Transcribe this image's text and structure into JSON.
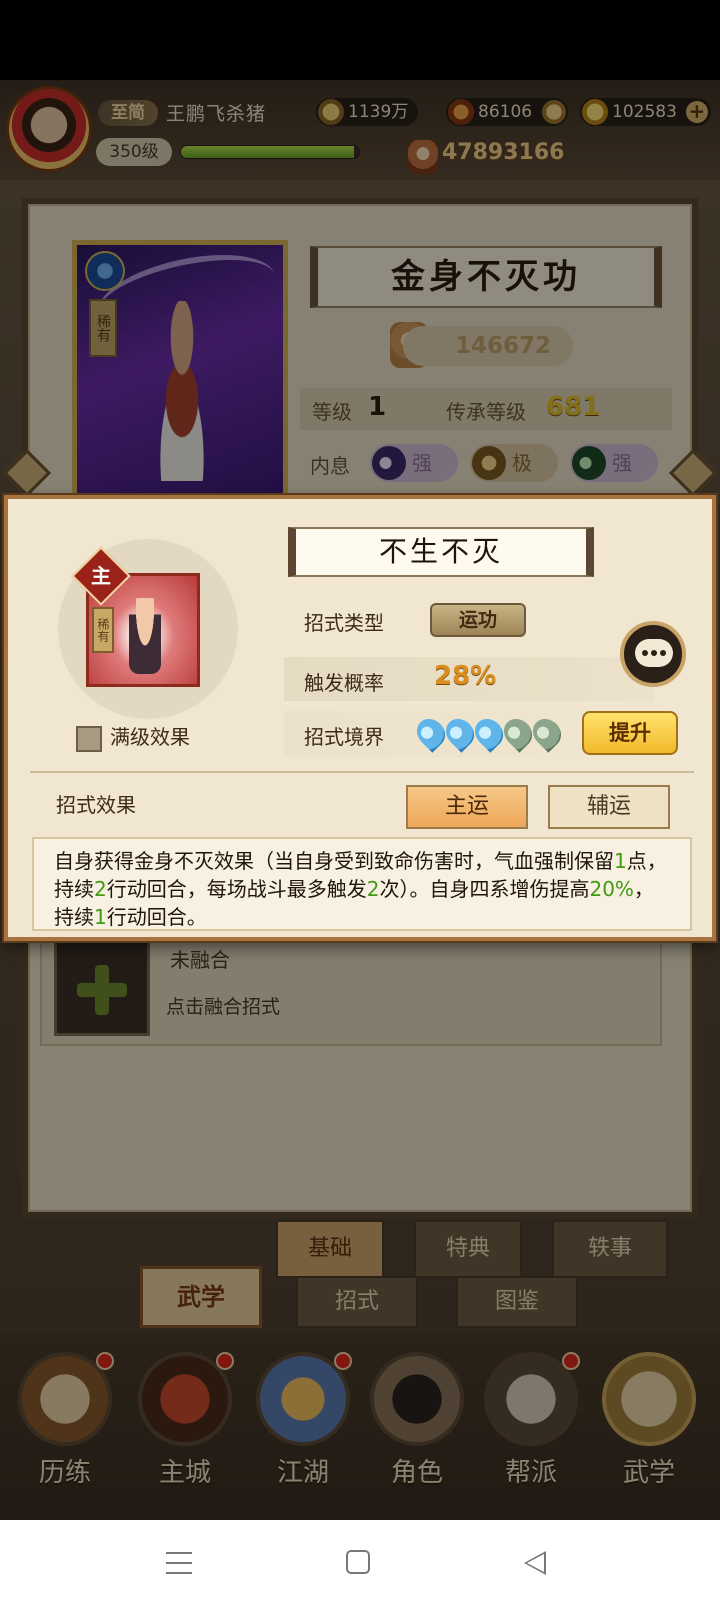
{
  "player": {
    "vip": "至简",
    "name": "王鹏飞杀猪",
    "level": "350级",
    "exp_fraction": 0.97,
    "power": "47893166"
  },
  "resources": {
    "coins": "1139万",
    "resource2": "86106",
    "gold": "102583"
  },
  "skill": {
    "title": "金身不灭功",
    "rarity": "稀有",
    "score": "146672",
    "level_label": "等级",
    "level_value": "1",
    "inherit_label": "传承等级",
    "inherit_value": "681",
    "breath_label": "内息",
    "breaths": [
      "强",
      "极",
      "强"
    ]
  },
  "fusion": {
    "title": "未融合",
    "hint": "点击融合招式"
  },
  "subtabs": {
    "basic": "基础",
    "classic": "特典",
    "anecdote": "轶事",
    "moves": "招式",
    "atlas": "图鉴",
    "martial_tag": "武学"
  },
  "nav": [
    {
      "label": "历练"
    },
    {
      "label": "主城"
    },
    {
      "label": "江湖"
    },
    {
      "label": "角色"
    },
    {
      "label": "帮派"
    },
    {
      "label": "武学"
    }
  ],
  "dialog": {
    "main_tag": "主",
    "rarity": "稀有",
    "max_level_label": "满级效果",
    "move_name": "不生不灭",
    "type_label": "招式类型",
    "type_value": "运功",
    "rate_label": "触发概率",
    "rate_value": "28%",
    "realm_label": "招式境界",
    "realm_level": 3,
    "realm_max": 5,
    "upgrade_label": "提升",
    "effect_label": "招式效果",
    "tab_main": "主运",
    "tab_aux": "辅运",
    "effect_text": [
      {
        "t": "自身获得金身不灭效果（当自身受到致命伤害时，气血强制保留",
        "hl": false
      },
      {
        "t": "1",
        "hl": true
      },
      {
        "t": "点，持续",
        "hl": false
      },
      {
        "t": "2",
        "hl": true
      },
      {
        "t": "行动回合，每场战斗最多触发",
        "hl": false
      },
      {
        "t": "2",
        "hl": true
      },
      {
        "t": "次）。自身四系增伤提高",
        "hl": false
      },
      {
        "t": "20%",
        "hl": true
      },
      {
        "t": "，持续",
        "hl": false
      },
      {
        "t": "1",
        "hl": true
      },
      {
        "t": "行动回合。",
        "hl": false
      }
    ]
  },
  "colors": {
    "highlight": "#3f9a12",
    "rate": "#d98e1f",
    "accent_gold": "#f2b82b"
  }
}
